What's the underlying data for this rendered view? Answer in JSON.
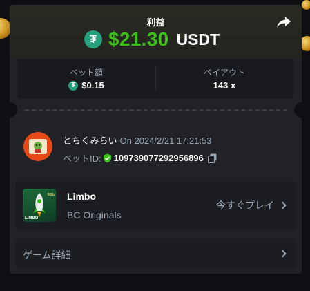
{
  "header": {
    "title": "利益",
    "profit_amount": "$21.30",
    "profit_currency": "USDT"
  },
  "stats": {
    "bet_amount_label": "ベット額",
    "bet_amount_value": "$0.15",
    "payout_label": "ペイアウト",
    "payout_value": "143 x"
  },
  "bet": {
    "username": "とちくみらい",
    "timestamp": "On 2024/2/21 17:21:53",
    "bet_id_label": "ベットID:",
    "bet_id": "109739077292956896"
  },
  "game": {
    "name": "Limbo",
    "provider": "BC Originals",
    "play_label": "今すぐプレイ",
    "thumb_label": "LIMBO"
  },
  "details": {
    "label": "ゲーム詳細"
  },
  "colors": {
    "profit": "#3bc117",
    "tether": "#26a17b",
    "avatar": "#e84a15"
  },
  "icons": [
    "tether-icon",
    "share-icon",
    "verified-shield-icon",
    "copy-icon",
    "chevron-right-icon"
  ]
}
